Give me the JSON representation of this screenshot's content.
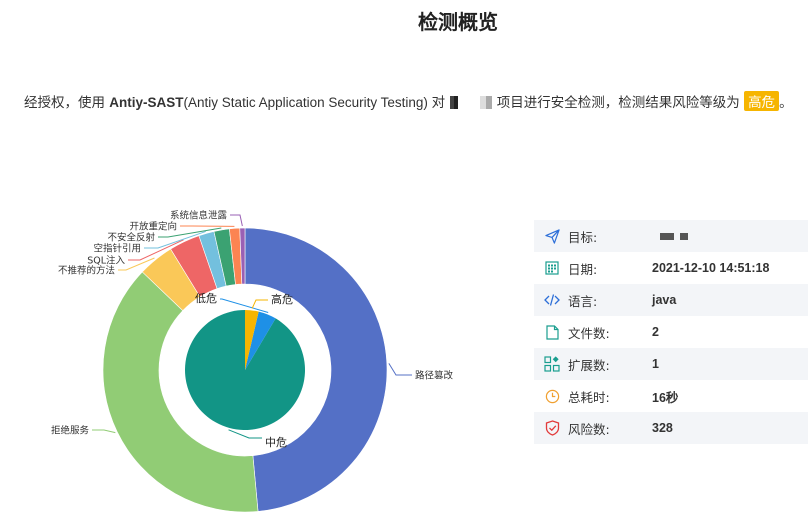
{
  "title": "检测概览",
  "summary": {
    "prefix": "经授权，使用 ",
    "product": "Antiy-SAST",
    "product_full": "(Antiy Static Application Security Testing) 对",
    "suffix": "项目进行安全检测，检测结果风险等级为 ",
    "risk_level": "高危",
    "end": "。",
    "risk_color": "#f6b500"
  },
  "chart_data": [
    {
      "type": "pie",
      "variant": "donut",
      "categories": [
        "路径篡改",
        "拒绝服务",
        "不推荐的方法",
        "SQL注入",
        "空指针引用",
        "不安全反射",
        "开放重定向",
        "系统信息泄露"
      ],
      "values": [
        166,
        132,
        14,
        12,
        6,
        6,
        4,
        2
      ],
      "colors": [
        "#5470c6",
        "#91cc75",
        "#fac858",
        "#ee6666",
        "#73c0de",
        "#3ba272",
        "#fc8452",
        "#9a60b4"
      ]
    },
    {
      "type": "pie",
      "categories": [
        "中危",
        "低危",
        "高危"
      ],
      "values": [
        300,
        16,
        12
      ],
      "colors": [
        "#129586",
        "#1e90e6",
        "#f6b500"
      ]
    }
  ],
  "info": {
    "rows": [
      {
        "icon": "send-icon",
        "label": "目标:",
        "value": ""
      },
      {
        "icon": "calendar-icon",
        "label": "日期:",
        "value": "2021-12-10 14:51:18"
      },
      {
        "icon": "code-icon",
        "label": "语言:",
        "value": "java"
      },
      {
        "icon": "file-icon",
        "label": "文件数:",
        "value": "2"
      },
      {
        "icon": "extension-icon",
        "label": "扩展数:",
        "value": "1"
      },
      {
        "icon": "clock-icon",
        "label": "总耗时:",
        "value": "16秒"
      },
      {
        "icon": "shield-icon",
        "label": "风险数:",
        "value": "328"
      }
    ]
  }
}
